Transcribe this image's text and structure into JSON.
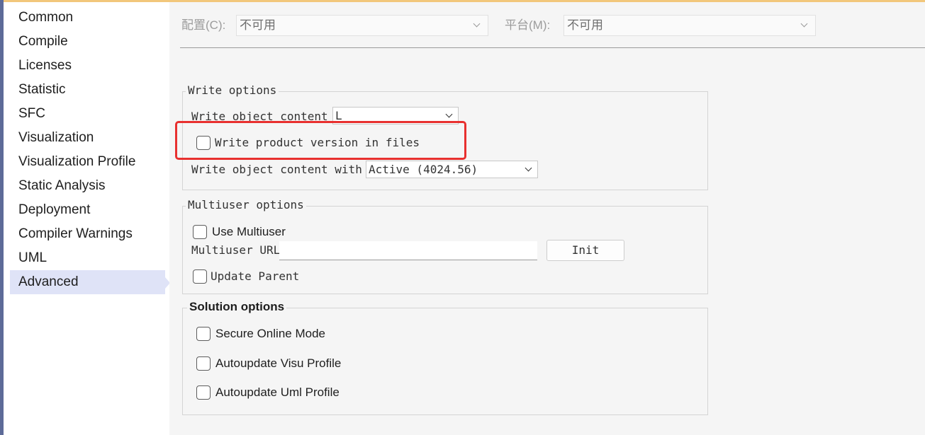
{
  "sidebar": {
    "items": [
      {
        "label": "Common"
      },
      {
        "label": "Compile"
      },
      {
        "label": "Licenses"
      },
      {
        "label": "Statistic"
      },
      {
        "label": "SFC"
      },
      {
        "label": "Visualization"
      },
      {
        "label": "Visualization Profile"
      },
      {
        "label": "Static Analysis"
      },
      {
        "label": "Deployment"
      },
      {
        "label": "Compiler Warnings"
      },
      {
        "label": "UML"
      },
      {
        "label": "Advanced"
      }
    ],
    "selected": "Advanced"
  },
  "toolbar": {
    "configuration_label": "配置(C):",
    "configuration_value": "不可用",
    "platform_label": "平台(M):",
    "platform_value": "不可用"
  },
  "write_options": {
    "legend": "Write options",
    "content_as_label": "Write object content as:",
    "content_as_value": "L",
    "product_version_label": "Write product version in files",
    "product_version_checked": false,
    "content_with_label": "Write object content with P",
    "content_with_value": "Active (4024.56)"
  },
  "multiuser_options": {
    "legend": "Multiuser options",
    "use_multiuser_label": "Use Multiuser",
    "use_multiuser_checked": false,
    "url_label": "Multiuser URL:",
    "url_value": "",
    "init_button": "Init",
    "update_parent_label": "Update Parent",
    "update_parent_checked": false
  },
  "solution_options": {
    "legend": "Solution options",
    "secure_online_label": "Secure Online Mode",
    "secure_online_checked": false,
    "autoupdate_visu_label": "Autoupdate Visu Profile",
    "autoupdate_visu_checked": false,
    "autoupdate_uml_label": "Autoupdate Uml Profile",
    "autoupdate_uml_checked": false
  },
  "colors": {
    "highlight": "#e8302f",
    "selected_nav": "#dfe3f7",
    "top_accent": "#f2c77b"
  }
}
